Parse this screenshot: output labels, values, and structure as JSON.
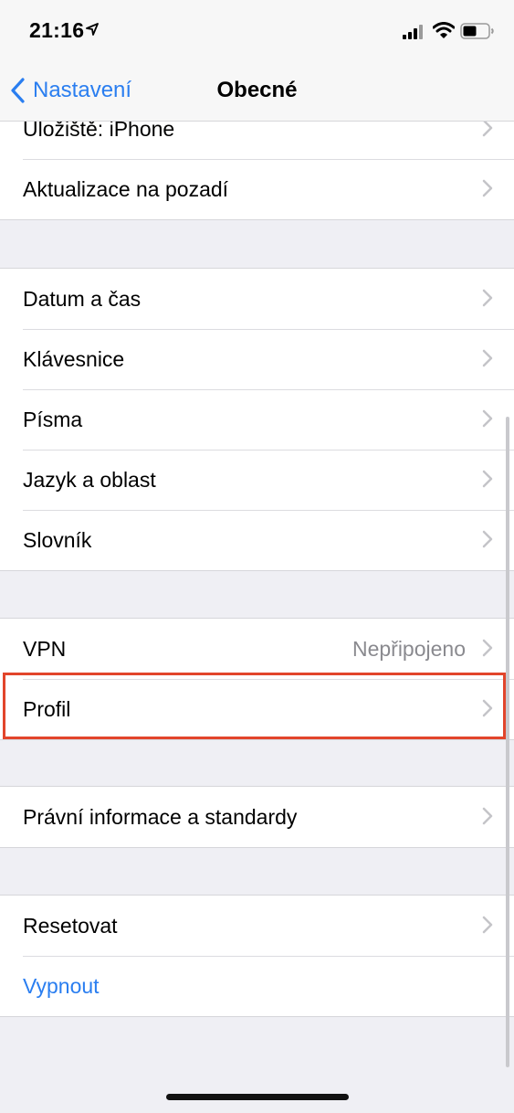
{
  "status_bar": {
    "time": "21:16"
  },
  "nav": {
    "back_label": "Nastavení",
    "title": "Obecné"
  },
  "groups": [
    {
      "rows": [
        {
          "label": "Uložiště: iPhone"
        },
        {
          "label": "Aktualizace na pozadí"
        }
      ]
    },
    {
      "rows": [
        {
          "label": "Datum a čas"
        },
        {
          "label": "Klávesnice"
        },
        {
          "label": "Písma"
        },
        {
          "label": "Jazyk a oblast"
        },
        {
          "label": "Slovník"
        }
      ]
    },
    {
      "rows": [
        {
          "label": "VPN",
          "value": "Nepřipojeno"
        },
        {
          "label": "Profil"
        }
      ]
    },
    {
      "rows": [
        {
          "label": "Právní informace a standardy"
        }
      ]
    },
    {
      "rows": [
        {
          "label": "Resetovat"
        },
        {
          "label": "Vypnout"
        }
      ]
    }
  ],
  "colors": {
    "accent": "#2a7ef0",
    "highlight_box": "#e2452b",
    "background": "#efeff4"
  }
}
